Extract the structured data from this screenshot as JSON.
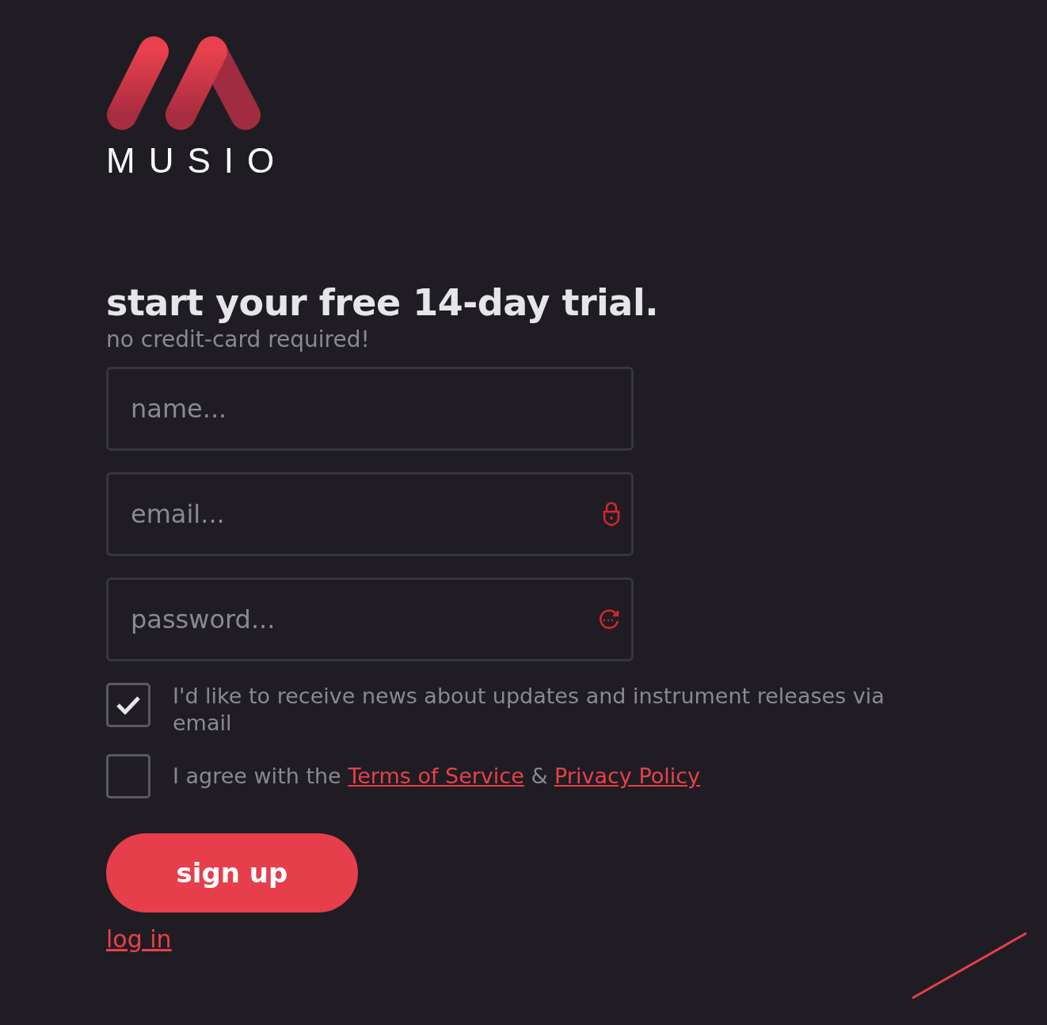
{
  "logo": {
    "wordmark": "MUSIO"
  },
  "heading": "start your free 14-day trial.",
  "subheading": "no credit-card required!",
  "fields": [
    {
      "kind": "text",
      "placeholder": "name..."
    },
    {
      "kind": "email",
      "placeholder": "email..."
    },
    {
      "kind": "password",
      "placeholder": "password..."
    }
  ],
  "options": [
    {
      "kind": "newsletter",
      "checked": true,
      "label": "I'd like to receive news about updates and instrument releases via email"
    },
    {
      "kind": "terms",
      "checked": false,
      "label": "I agree with the ",
      "links": [
        "Terms of Service",
        "Privacy Policy"
      ],
      "joiner": " & "
    }
  ],
  "submit": "sign up",
  "login_link": "log in"
}
